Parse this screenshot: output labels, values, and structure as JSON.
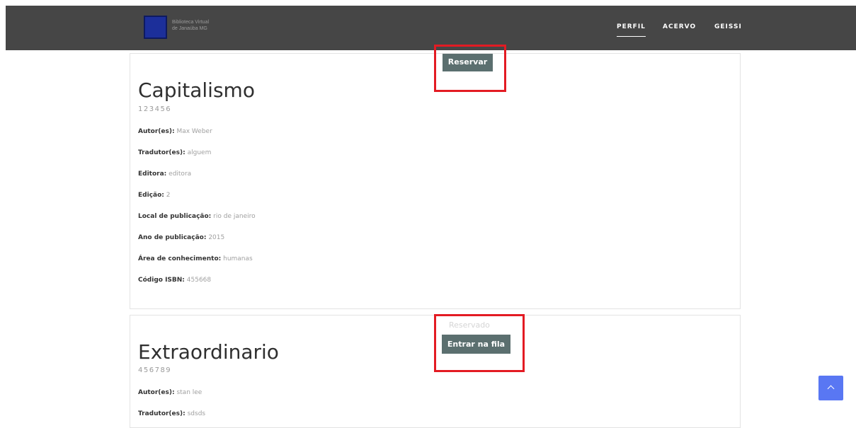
{
  "header": {
    "logo_line1": "Biblioteca Virtual",
    "logo_line2": "de Janaúba MG",
    "nav": [
      "PERFIL",
      "ACERVO",
      "GEISSI"
    ]
  },
  "books": [
    {
      "title": "Capitalismo",
      "code": "123456",
      "action_label": "Reservar",
      "fields": [
        {
          "label": "Autor(es):",
          "value": "Max Weber"
        },
        {
          "label": "Tradutor(es):",
          "value": "alguem"
        },
        {
          "label": "Editora:",
          "value": "editora"
        },
        {
          "label": "Edição:",
          "value": "2"
        },
        {
          "label": "Local de publicação:",
          "value": "rio de janeiro"
        },
        {
          "label": "Ano de publicação:",
          "value": "2015"
        },
        {
          "label": "Área de conhecimento:",
          "value": "humanas"
        },
        {
          "label": "Código ISBN:",
          "value": "455668"
        }
      ]
    },
    {
      "title": "Extraordinario",
      "code": "456789",
      "status": "Reservado",
      "action_label": "Entrar na fila",
      "fields": [
        {
          "label": "Autor(es):",
          "value": "stan lee"
        },
        {
          "label": "Tradutor(es):",
          "value": "sdsds"
        }
      ]
    }
  ],
  "colors": {
    "navbar_bg": "#464646",
    "button_bg": "#5b6f6f",
    "highlight_red": "#e31b23",
    "scroll_top_bg": "#5977f3"
  },
  "icons": {
    "logo": "book-logo-icon",
    "scroll_top": "chevron-up-icon"
  }
}
